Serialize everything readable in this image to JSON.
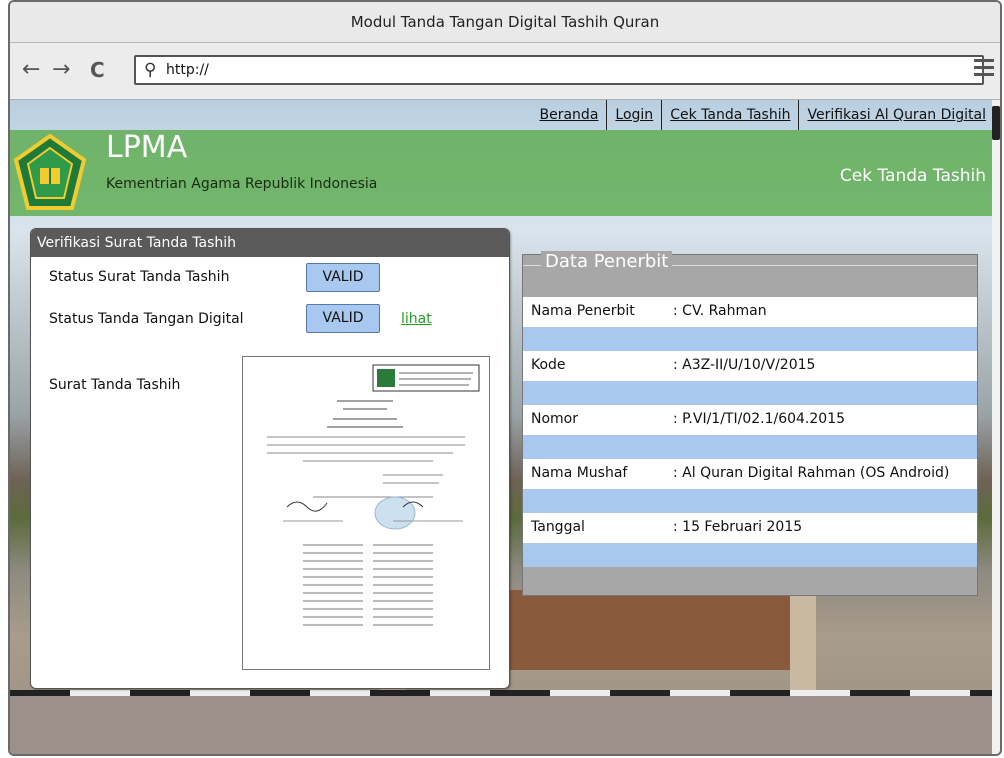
{
  "window": {
    "title": "Modul Tanda Tangan Digital Tashih Quran"
  },
  "toolbar": {
    "url": "http://"
  },
  "nav": {
    "items": [
      {
        "label": "Beranda"
      },
      {
        "label": "Login"
      },
      {
        "label": "Cek Tanda Tashih"
      },
      {
        "label": "Verifikasi Al Quran Digital"
      }
    ]
  },
  "header": {
    "brand": "LPMA",
    "subtitle": "Kementrian Agama Republik Indonesia",
    "page_title": "Cek Tanda Tashih"
  },
  "verifikasi": {
    "title": "Verifikasi Surat Tanda Tashih",
    "status_surat_label": "Status Surat Tanda Tashih",
    "status_surat_value": "VALID",
    "status_ttd_label": "Status Tanda Tangan Digital",
    "status_ttd_value": "VALID",
    "lihat": "lihat",
    "surat_label": "Surat Tanda Tashih"
  },
  "penerbit": {
    "title": "Data Penerbit",
    "rows": [
      {
        "label": "Nama Penerbit",
        "value": ": CV. Rahman"
      },
      {
        "label": "Kode",
        "value": ": A3Z-II/U/10/V/2015"
      },
      {
        "label": "Nomor",
        "value": ": P.VI/1/TI/02.1/604.2015"
      },
      {
        "label": "Nama Mushaf",
        "value": ": Al Quran Digital Rahman (OS Android)"
      },
      {
        "label": "Tanggal",
        "value": ": 15 Februari 2015"
      }
    ]
  },
  "icons": {
    "back": "back-arrow-icon",
    "forward": "forward-arrow-icon",
    "reload": "reload-icon",
    "search": "search-icon",
    "menu": "hamburger-menu-icon",
    "logo": "kemenag-logo"
  }
}
